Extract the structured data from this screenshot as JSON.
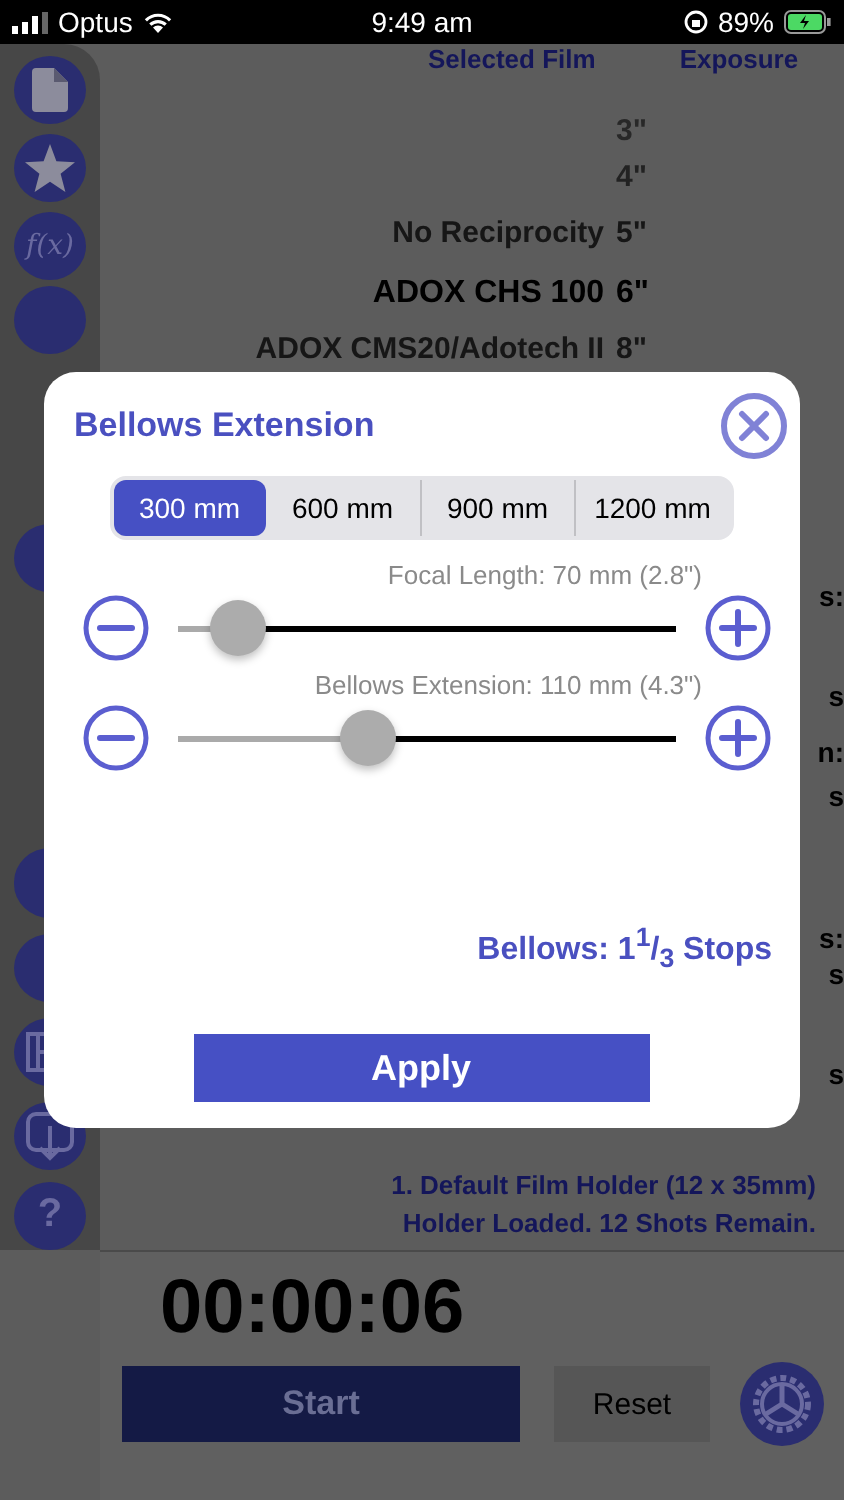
{
  "status_bar": {
    "carrier": "Optus",
    "time": "9:49 am",
    "battery": "89%"
  },
  "sidebar": [
    {
      "kind": "document"
    },
    {
      "kind": "star"
    },
    {
      "kind": "function",
      "label": "f(x)"
    },
    {
      "kind": "round"
    },
    {
      "kind": "round"
    },
    {
      "kind": "round"
    },
    {
      "kind": "round"
    },
    {
      "kind": "film"
    },
    {
      "kind": "download"
    },
    {
      "kind": "help",
      "label": "?"
    }
  ],
  "columns": [
    "Selected Film",
    "Exposure"
  ],
  "picker": [
    {
      "exposure": "3\"",
      "selected": false
    },
    {
      "exposure": "4\"",
      "selected": false
    },
    {
      "film": "No Reciprocity",
      "exposure": "5\"",
      "selected": false
    },
    {
      "film": "ADOX CHS 100",
      "exposure": "6\"",
      "selected": true
    },
    {
      "film": "ADOX CMS20/Adotech II",
      "exposure": "8\"",
      "selected": false
    }
  ],
  "edge_fragments": [
    "s:",
    "s",
    "n:",
    "s",
    "s:",
    "s",
    "s"
  ],
  "holder": {
    "name": "1. Default Film Holder (12 x 35mm)",
    "status": "Holder Loaded. 12 Shots Remain."
  },
  "timer": {
    "time": "00:00:06",
    "start": "Start",
    "reset": "Reset"
  },
  "dialog": {
    "title": "Bellows Extension",
    "segments": [
      {
        "label": "300 mm",
        "selected": true
      },
      {
        "label": "600 mm",
        "selected": false
      },
      {
        "label": "900 mm",
        "selected": false
      },
      {
        "label": "1200 mm",
        "selected": false
      }
    ],
    "sliders": [
      {
        "label": "Focal Length: 70 mm (2.8\")",
        "level": 0.12
      },
      {
        "label": "Bellows Extension: 110 mm (4.3\")",
        "level": 0.38
      }
    ],
    "result": "Bellows: 1$^{1}$/$_{3}$ Stops",
    "apply": "Apply"
  }
}
